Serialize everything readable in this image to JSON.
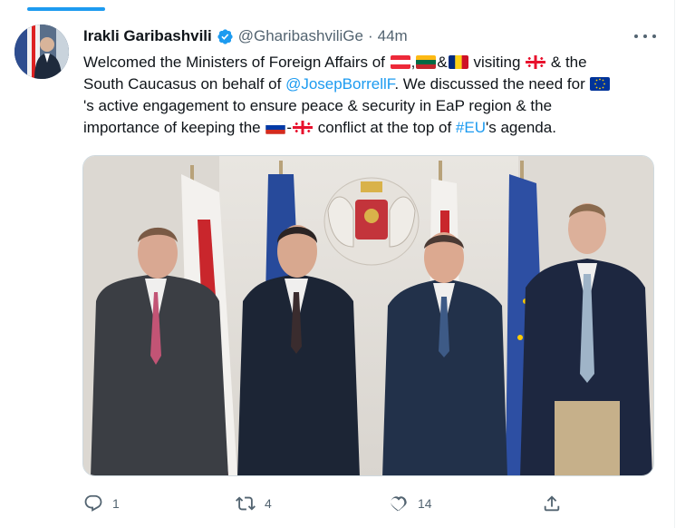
{
  "tweet": {
    "display_name": "Irakli Garibashvili",
    "verified": true,
    "handle": "@GharibashviliGe",
    "separator": "·",
    "time": "44m",
    "text": {
      "l1_a": "Welcomed the Ministers of Foreign Affairs of",
      "l1_comma": ",",
      "l1_amp": "&",
      "l1_b": "visiting",
      "l1_c": "& the",
      "l2_a": "South Caucasus on behalf of",
      "l2_mention": "@JosepBorrellF",
      "l2_b": ". We discussed the need for",
      "l3_a": "'s active engagement to ensure peace & security in EaP region & the",
      "l4_a": "importance of keeping the",
      "l4_dash": "-",
      "l4_b": "conflict at the top of",
      "l4_hashtag": "#EU",
      "l4_c": "'s agenda."
    },
    "flags": [
      "austria-flag",
      "lithuania-flag",
      "romania-flag",
      "georgia-flag",
      "eu-flag",
      "russia-flag",
      "georgia-flag"
    ],
    "actions": {
      "reply_count": "1",
      "retweet_count": "4",
      "like_count": "14"
    }
  },
  "colors": {
    "link": "#1d9bf0",
    "secondary_text": "#536471",
    "primary_text": "#0f1419"
  },
  "icons": [
    "verified-badge-icon",
    "more-icon",
    "reply-icon",
    "retweet-icon",
    "like-icon",
    "share-icon"
  ]
}
